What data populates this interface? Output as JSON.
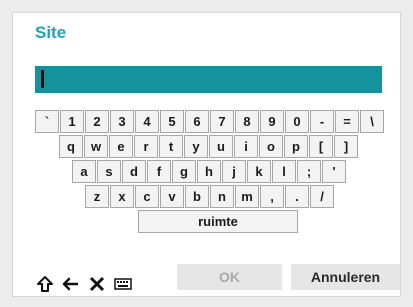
{
  "dialog": {
    "title": "Site",
    "input_value": "",
    "ok_label": "OK",
    "cancel_label": "Annuleren"
  },
  "keyboard": {
    "row1": [
      "`",
      "1",
      "2",
      "3",
      "4",
      "5",
      "6",
      "7",
      "8",
      "9",
      "0",
      "-",
      "=",
      "\\"
    ],
    "row2": [
      "q",
      "w",
      "e",
      "r",
      "t",
      "y",
      "u",
      "i",
      "o",
      "p",
      "[",
      "]"
    ],
    "row3": [
      "a",
      "s",
      "d",
      "f",
      "g",
      "h",
      "j",
      "k",
      "l",
      ";",
      "'"
    ],
    "row4": [
      "z",
      "x",
      "c",
      "v",
      "b",
      "n",
      "m",
      ",",
      ".",
      "/"
    ],
    "space_label": "ruimte"
  },
  "tools": {
    "icons": [
      "shift-icon",
      "backspace-icon",
      "clear-icon",
      "keyboard-icon"
    ]
  }
}
